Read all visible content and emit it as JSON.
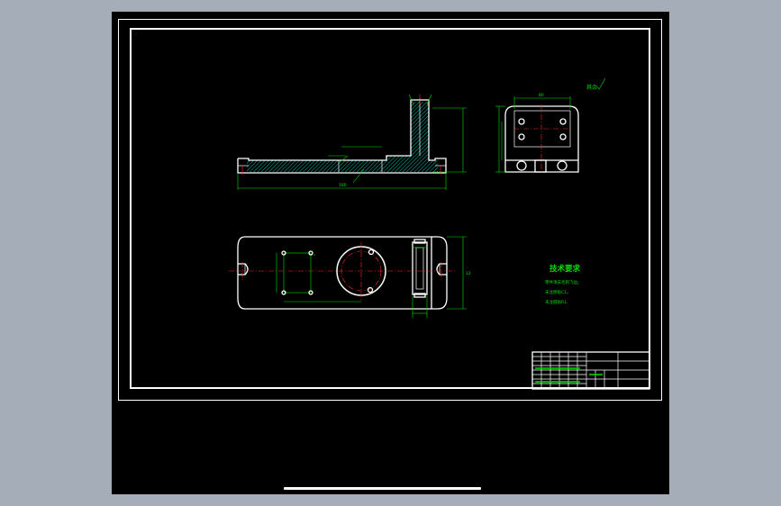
{
  "drawing": {
    "notes_title": "技术要求",
    "notes": [
      "零件须去毛刺飞边。",
      "未注倒角C1。",
      "未注圆角R1."
    ],
    "surface_finish": "其余",
    "dim_top_overall": "80",
    "dim_front_length": "180",
    "dim_small": "12",
    "title_block": {
      "label": "",
      "scale": ""
    }
  },
  "colors": {
    "outline": "#ffffff",
    "dimension": "#00e000",
    "centerline": "#ff2a2a",
    "background": "#000000",
    "chrome": "#a4adb8"
  }
}
